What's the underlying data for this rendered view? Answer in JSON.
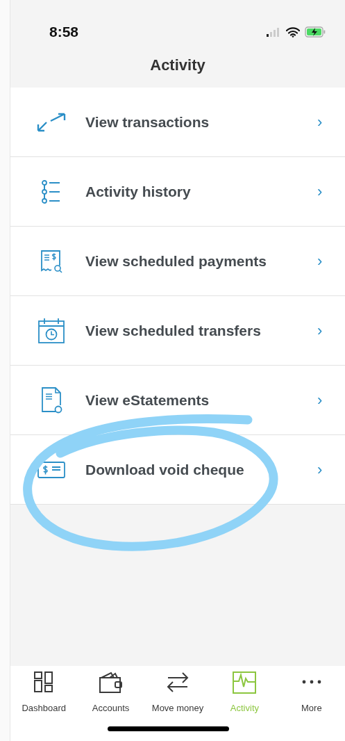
{
  "status_bar": {
    "time": "8:58"
  },
  "header": {
    "title": "Activity"
  },
  "menu_items": [
    {
      "kind": "transactions",
      "label": "View transactions",
      "chevron": "›"
    },
    {
      "kind": "history",
      "label": "Activity history",
      "chevron": "›"
    },
    {
      "kind": "payments",
      "label": "View scheduled payments",
      "chevron": "›"
    },
    {
      "kind": "transfers",
      "label": "View scheduled transfers",
      "chevron": "›"
    },
    {
      "kind": "statements",
      "label": "View eStatements",
      "chevron": "›"
    },
    {
      "kind": "cheque",
      "label": "Download void cheque",
      "chevron": "›"
    }
  ],
  "tab_bar": [
    {
      "kind": "dashboard",
      "label": "Dashboard",
      "selected": false
    },
    {
      "kind": "accounts",
      "label": "Accounts",
      "selected": false
    },
    {
      "kind": "move",
      "label": "Move money",
      "selected": false
    },
    {
      "kind": "activity",
      "label": "Activity",
      "selected": true
    },
    {
      "kind": "more",
      "label": "More",
      "selected": false
    }
  ]
}
